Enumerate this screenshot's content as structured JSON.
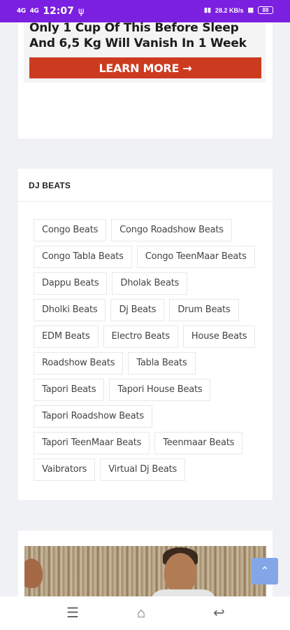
{
  "status_bar": {
    "time": "12:07",
    "left_signal_1": "4G",
    "left_signal_2": "4G",
    "right_speed": "28.2 KB/s",
    "battery_label": "88",
    "icons": [
      "signal-icon",
      "usb-icon",
      "volte-icon",
      "battery-icon"
    ]
  },
  "ad": {
    "headline": "Only 1 Cup Of This Before Sleep And 6,5 Kg Will Vanish In 1 Week",
    "button_label": "LEARN MORE →",
    "button_color": "#cc3b1f"
  },
  "tags_section": {
    "title": "DJ BEATS",
    "tags": [
      "Congo Beats",
      "Congo Roadshow Beats",
      "Congo Tabla Beats",
      "Congo TeenMaar Beats",
      "Dappu Beats",
      "Dholak Beats",
      "Dholki Beats",
      "Dj Beats",
      "Drum Beats",
      "EDM Beats",
      "Electro Beats",
      "House Beats",
      "Roadshow Beats",
      "Tabla Beats",
      "Tapori Beats",
      "Tapori House Beats",
      "Tapori Roadshow Beats",
      "Tapori TeenMaar Beats",
      "Teenmaar Beats",
      "Vaibrators",
      "Virtual Dj Beats"
    ]
  },
  "scroll_top": {
    "icon": "chevron-up-icon",
    "glyph": "⌃",
    "color": "#82a6e6"
  },
  "nav": {
    "menu_glyph": "☰",
    "home_glyph": "⌂",
    "back_glyph": "↩"
  },
  "theme": {
    "status_bar_color": "#7b1fe0",
    "background": "#f0f1f4"
  }
}
